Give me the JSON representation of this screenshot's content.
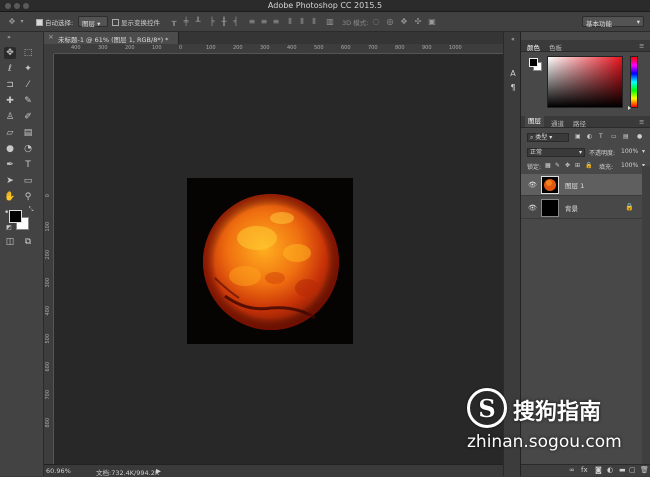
{
  "app": {
    "title": "Adobe Photoshop CC 2015.5"
  },
  "options_bar": {
    "auto_select_label": "自动选择:",
    "auto_select_target": "图层",
    "show_transform_label": "显示变换控件",
    "mode_3d_label": "3D 模式:",
    "workspace": "基本功能"
  },
  "document": {
    "tab_title": "未标题-1 @ 61% (图层 1, RGB/8*) *",
    "ruler_h_ticks": [
      "500",
      "400",
      "300",
      "200",
      "100",
      "0",
      "100",
      "200",
      "300",
      "400",
      "500",
      "600",
      "700",
      "800",
      "900",
      "1000"
    ],
    "ruler_v_ticks": [
      "0",
      "100",
      "200",
      "300",
      "400",
      "500",
      "600",
      "700",
      "800"
    ]
  },
  "status": {
    "zoom": "60.96%",
    "doc_info": "文档:732.4K/994.2K"
  },
  "color_panel": {
    "tabs": [
      "颜色",
      "色板"
    ],
    "foreground": "#000000",
    "background": "#ffffff"
  },
  "layers_panel": {
    "tabs": [
      "图层",
      "通道",
      "路径"
    ],
    "filter_label": "类型",
    "blend_mode": "正常",
    "opacity_label": "不透明度:",
    "opacity_value": "100%",
    "lock_label": "锁定:",
    "fill_label": "填充:",
    "fill_value": "100%",
    "layers": [
      {
        "name": "图层 1",
        "selected": true
      },
      {
        "name": "背景",
        "selected": false,
        "locked": true
      }
    ]
  },
  "watermark": {
    "logo_letter": "S",
    "brand": "搜狗指南",
    "url": "zhinan.sogou.com"
  }
}
